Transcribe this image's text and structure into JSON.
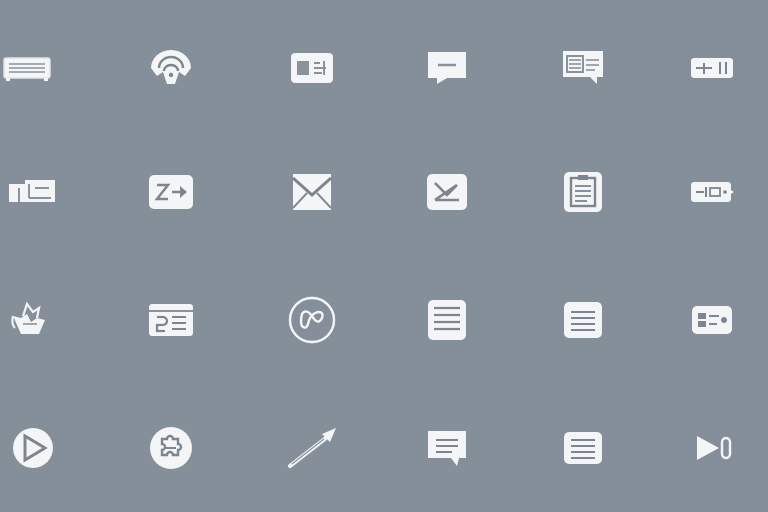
{
  "colors": {
    "background": "#858f99",
    "icon_fill": "#f4f5f6",
    "icon_line": "#6b7580"
  },
  "icons": [
    [
      "keyboard-icon",
      "wifi-icon",
      "id-card-icon",
      "chat-bubble-icon",
      "document-speech-icon",
      "ruler-icon"
    ],
    [
      "folder-card-icon",
      "arrow-card-icon",
      "envelope-icon",
      "mail-check-icon",
      "clipboard-icon",
      "ticket-icon"
    ],
    [
      "basket-icon",
      "browser-window-icon",
      "circle-knot-icon",
      "text-list-icon",
      "notes-icon",
      "id-badge-icon"
    ],
    [
      "play-circle-icon",
      "puzzle-circle-icon",
      "pen-icon",
      "message-icon",
      "list-card-icon",
      "play-counter-icon"
    ]
  ]
}
